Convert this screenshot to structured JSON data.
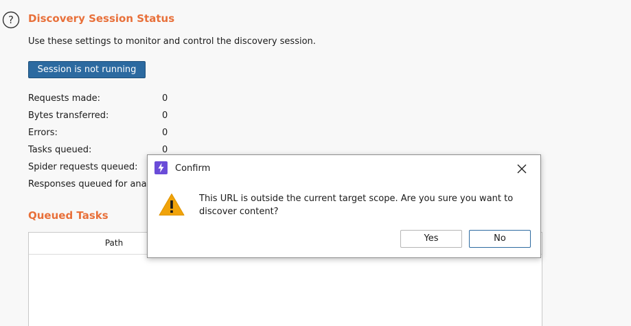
{
  "status": {
    "title": "Discovery Session Status",
    "description": "Use these settings to monitor and control the discovery session.",
    "session_button": "Session is not running",
    "stats": [
      {
        "label": "Requests made:",
        "value": "0"
      },
      {
        "label": "Bytes transferred:",
        "value": "0"
      },
      {
        "label": "Errors:",
        "value": "0"
      },
      {
        "label": "Tasks queued:",
        "value": "0"
      },
      {
        "label": "Spider requests queued:",
        "value": ""
      },
      {
        "label": "Responses queued for analy",
        "value": ""
      }
    ]
  },
  "queued": {
    "title": "Queued Tasks",
    "columns": [
      "Path"
    ]
  },
  "dialog": {
    "title": "Confirm",
    "message": "This URL is outside the current target scope. Are you sure you want to discover content?",
    "yes_label": "Yes",
    "no_label": "No"
  },
  "colors": {
    "accent": "#e8703a",
    "primary_button": "#2c6aa0",
    "warning": "#f0a30a",
    "logo": "#6a4cd8"
  },
  "icons": [
    "help-icon",
    "app-logo-icon",
    "close-icon",
    "warning-icon"
  ]
}
